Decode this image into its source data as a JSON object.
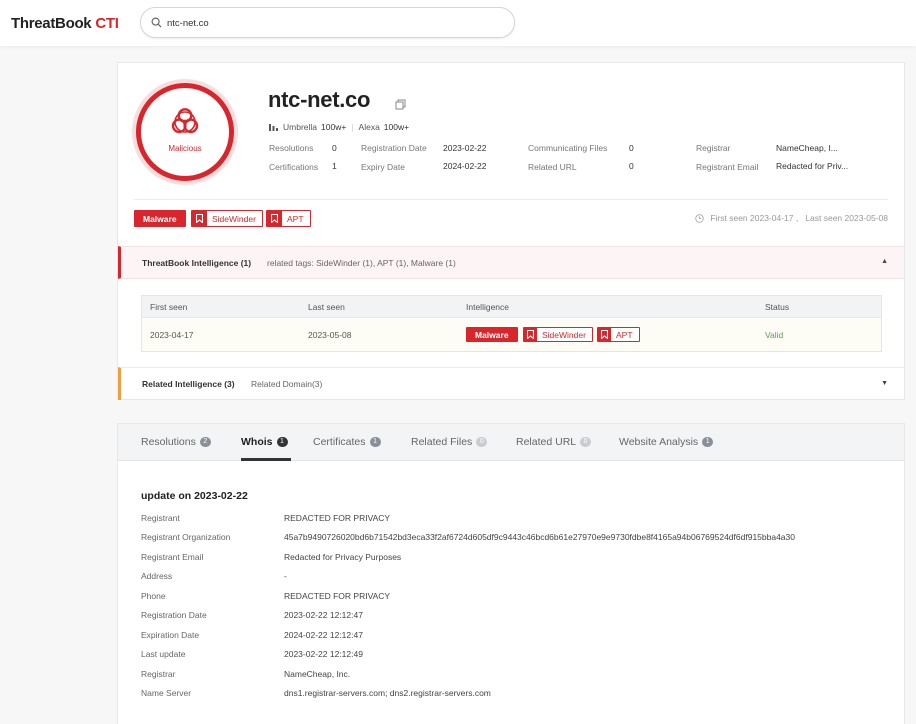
{
  "app": {
    "logo_main": "ThreatBook",
    "logo_accent": "CTI"
  },
  "search": {
    "value": "ntc-net.co",
    "placeholder": ""
  },
  "summary": {
    "verdict": "Malicious",
    "domain": "ntc-net.co",
    "ranks": [
      {
        "name": "Umbrella",
        "value": "100w+"
      },
      {
        "name": "Alexa",
        "value": "100w+"
      }
    ],
    "stats": {
      "resolutions_label": "Resolutions",
      "resolutions_value": "0",
      "certifications_label": "Certifications",
      "certifications_value": "1",
      "registration_date_label": "Registration Date",
      "registration_date_value": "2023-02-22",
      "expiry_date_label": "Expiry Date",
      "expiry_date_value": "2024-02-22",
      "communicating_files_label": "Communicating Files",
      "communicating_files_value": "0",
      "related_url_label": "Related URL",
      "related_url_value": "0",
      "registrar_label": "Registrar",
      "registrar_value": "NameCheap, I...",
      "registrant_email_label": "Registrant Email",
      "registrant_email_value": "Redacted for Priv..."
    },
    "tags": {
      "malware": "Malware",
      "sidewinder": "SideWinder",
      "apt": "APT"
    },
    "seen_text": "First seen 2023-04-17 ,   Last seen 2023-05-08"
  },
  "threatbook_intel": {
    "title": "ThreatBook Intelligence (1)",
    "related_tags": "related tags: SideWinder (1), APT (1), Malware (1)",
    "columns": {
      "first_seen": "First seen",
      "last_seen": "Last seen",
      "intelligence": "Intelligence",
      "status": "Status"
    },
    "rows": [
      {
        "first_seen": "2023-04-17",
        "last_seen": "2023-05-08",
        "tag_malware": "Malware",
        "tag_sidewinder": "SideWinder",
        "tag_apt": "APT",
        "status": "Valid"
      }
    ]
  },
  "related_intel": {
    "title": "Related Intelligence (3)",
    "subtitle": "Related Domain(3)"
  },
  "tabs": [
    {
      "label": "Resolutions",
      "count": "2"
    },
    {
      "label": "Whois",
      "count": "1"
    },
    {
      "label": "Certificates",
      "count": "1"
    },
    {
      "label": "Related Files",
      "count": "0"
    },
    {
      "label": "Related URL",
      "count": "0"
    },
    {
      "label": "Website Analysis",
      "count": "1"
    }
  ],
  "whois": {
    "title": "update on 2023-02-22",
    "rows": [
      {
        "label": "Registrant",
        "value": "REDACTED FOR PRIVACY"
      },
      {
        "label": "Registrant Organization",
        "value": "45a7b9490726020bd6b71542bd3eca33f2af6724d605df9c9443c46bcd6b61e27970e9e9730fdbe8f4165a94b06769524df6df915bba4a30"
      },
      {
        "label": "Registrant Email",
        "value": "Redacted for Privacy Purposes"
      },
      {
        "label": "Address",
        "value": "-"
      },
      {
        "label": "Phone",
        "value": "REDACTED FOR PRIVACY"
      },
      {
        "label": "Registration Date",
        "value": "2023-02-22 12:12:47"
      },
      {
        "label": "Expiration Date",
        "value": "2024-02-22 12:12:47"
      },
      {
        "label": "Last update",
        "value": "2023-02-22 12:12:49"
      },
      {
        "label": "Registrar",
        "value": "NameCheap, Inc."
      },
      {
        "label": "Name Server",
        "value": "dns1.registrar-servers.com; dns2.registrar-servers.com"
      }
    ]
  },
  "colors": {
    "accent_red": "#d9262c",
    "related_orange": "#f0a044",
    "valid_green": "#52a552"
  }
}
